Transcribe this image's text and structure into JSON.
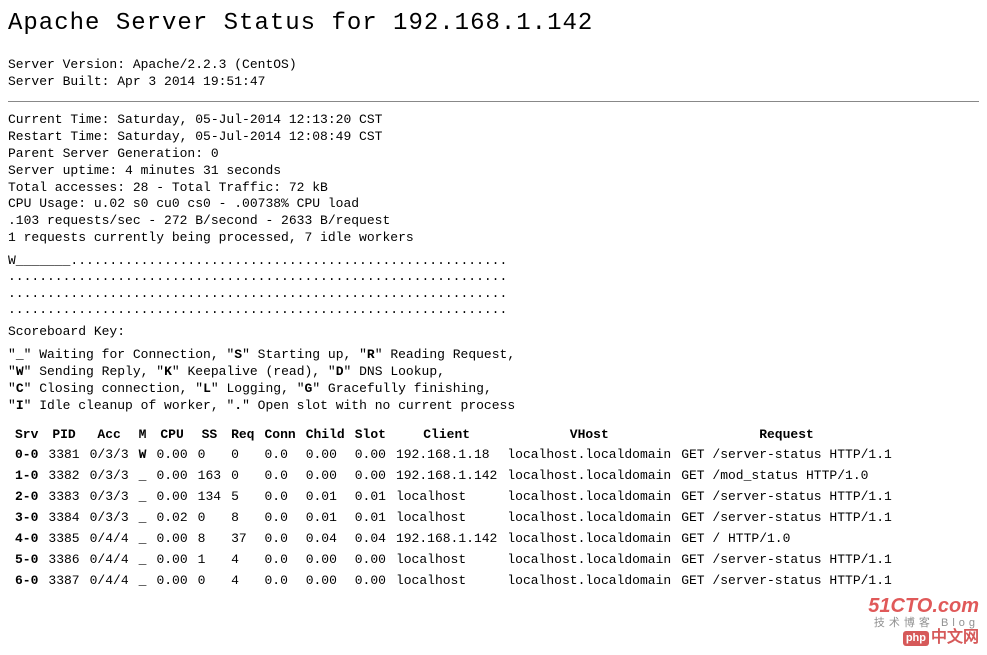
{
  "title": "Apache Server Status for 192.168.1.142",
  "server_info": {
    "version_label": "Server Version: Apache/2.2.3 (CentOS)",
    "built_label": "Server Built: Apr 3 2014 19:51:47"
  },
  "stats": [
    "Current Time: Saturday, 05-Jul-2014 12:13:20 CST",
    "Restart Time: Saturday, 05-Jul-2014 12:08:49 CST",
    "Parent Server Generation: 0",
    "Server uptime: 4 minutes 31 seconds",
    "Total accesses: 28 - Total Traffic: 72 kB",
    "CPU Usage: u.02 s0 cu0 cs0 - .00738% CPU load",
    ".103 requests/sec - 272 B/second - 2633 B/request",
    "1 requests currently being processed, 7 idle workers"
  ],
  "scoreboard": "W_______........................................................\n................................................................\n................................................................\n................................................................",
  "key_heading": "Scoreboard Key:",
  "key_lines": [
    {
      "segments": [
        [
          "\""
        ],
        [
          "_",
          true
        ],
        [
          "\" Waiting for Connection, \""
        ],
        [
          "S",
          true
        ],
        [
          "\" Starting up, \""
        ],
        [
          "R",
          true
        ],
        [
          "\" Reading Request,"
        ]
      ]
    },
    {
      "segments": [
        [
          "\""
        ],
        [
          "W",
          true
        ],
        [
          "\" Sending Reply, \""
        ],
        [
          "K",
          true
        ],
        [
          "\" Keepalive (read), \""
        ],
        [
          "D",
          true
        ],
        [
          "\" DNS Lookup,"
        ]
      ]
    },
    {
      "segments": [
        [
          "\""
        ],
        [
          "C",
          true
        ],
        [
          "\" Closing connection, \""
        ],
        [
          "L",
          true
        ],
        [
          "\" Logging, \""
        ],
        [
          "G",
          true
        ],
        [
          "\" Gracefully finishing,"
        ]
      ]
    },
    {
      "segments": [
        [
          "\""
        ],
        [
          "I",
          true
        ],
        [
          "\" Idle cleanup of worker, \""
        ],
        [
          ".",
          true
        ],
        [
          "\" Open slot with no current process"
        ]
      ]
    }
  ],
  "table": {
    "headers": [
      "Srv",
      "PID",
      "Acc",
      "M",
      "CPU",
      "SS",
      "Req",
      "Conn",
      "Child",
      "Slot",
      "Client",
      "VHost",
      "Request"
    ],
    "rows": [
      [
        "0-0",
        "3381",
        "0/3/3",
        "W",
        "0.00",
        "0",
        "0",
        "0.0",
        "0.00",
        "0.00",
        "192.168.1.18",
        "localhost.localdomain",
        "GET /server-status HTTP/1.1"
      ],
      [
        "1-0",
        "3382",
        "0/3/3",
        "_",
        "0.00",
        "163",
        "0",
        "0.0",
        "0.00",
        "0.00",
        "192.168.1.142",
        "localhost.localdomain",
        "GET /mod_status HTTP/1.0"
      ],
      [
        "2-0",
        "3383",
        "0/3/3",
        "_",
        "0.00",
        "134",
        "5",
        "0.0",
        "0.01",
        "0.01",
        "localhost",
        "localhost.localdomain",
        "GET /server-status HTTP/1.1"
      ],
      [
        "3-0",
        "3384",
        "0/3/3",
        "_",
        "0.02",
        "0",
        "8",
        "0.0",
        "0.01",
        "0.01",
        "localhost",
        "localhost.localdomain",
        "GET /server-status HTTP/1.1"
      ],
      [
        "4-0",
        "3385",
        "0/4/4",
        "_",
        "0.00",
        "8",
        "37",
        "0.0",
        "0.04",
        "0.04",
        "192.168.1.142",
        "localhost.localdomain",
        "GET / HTTP/1.0"
      ],
      [
        "5-0",
        "3386",
        "0/4/4",
        "_",
        "0.00",
        "1",
        "4",
        "0.0",
        "0.00",
        "0.00",
        "localhost",
        "localhost.localdomain",
        "GET /server-status HTTP/1.1"
      ],
      [
        "6-0",
        "3387",
        "0/4/4",
        "_",
        "0.00",
        "0",
        "4",
        "0.0",
        "0.00",
        "0.00",
        "localhost",
        "localhost.localdomain",
        "GET /server-status HTTP/1.1"
      ]
    ]
  },
  "watermark": {
    "top": "51CTO.com",
    "mid": "技术博客 Blog",
    "bot": "中文网",
    "bot_prefix": "php"
  }
}
